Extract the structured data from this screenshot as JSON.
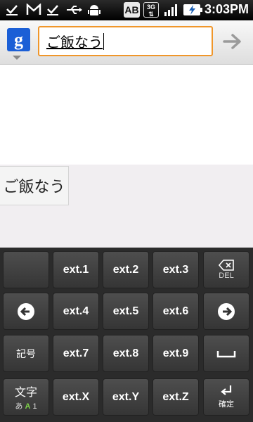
{
  "status_bar": {
    "time": "3:03PM",
    "ab_label": "AB",
    "network_label": "3G"
  },
  "search": {
    "query": "ご飯なう",
    "placeholder": ""
  },
  "candidates": [
    "ご飯なう"
  ],
  "keyboard": {
    "rows": [
      [
        {
          "label": ""
        },
        {
          "label": "ext.1"
        },
        {
          "label": "ext.2"
        },
        {
          "label": "ext.3"
        },
        {
          "label": "DEL"
        }
      ],
      [
        {
          "label": ""
        },
        {
          "label": "ext.4"
        },
        {
          "label": "ext.5"
        },
        {
          "label": "ext.6"
        },
        {
          "label": ""
        }
      ],
      [
        {
          "label": "記号"
        },
        {
          "label": "ext.7"
        },
        {
          "label": "ext.8"
        },
        {
          "label": "ext.9"
        },
        {
          "label": ""
        }
      ],
      [
        {
          "label": "文字",
          "sub": "あ A 1"
        },
        {
          "label": "ext.X"
        },
        {
          "label": "ext.Y"
        },
        {
          "label": "ext.Z"
        },
        {
          "label": "確定"
        }
      ]
    ]
  },
  "colors": {
    "accent": "#f0962a",
    "google_blue": "#1b5fd6",
    "keyboard_bg": "#2b2b2b",
    "key_bg": "#454545"
  }
}
